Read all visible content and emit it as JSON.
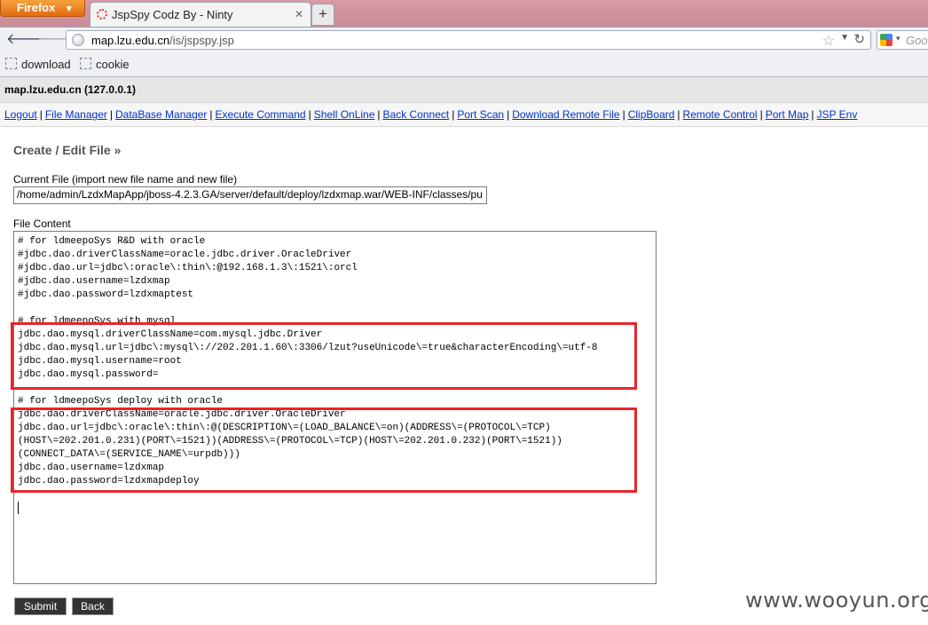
{
  "browser": {
    "app_button": "Firefox",
    "tab_title": "JspSpy Codz By - Ninty",
    "url": "map.lzu.edu.cn/is/jspspy.jsp",
    "url_host": "map.lzu.edu.cn",
    "url_path": "/is/jspspy.jsp",
    "search_placeholder": "Goo"
  },
  "bookmarks": [
    "download",
    "cookie"
  ],
  "page": {
    "host": "map.lzu.edu.cn (127.0.0.1)",
    "menu": [
      "Logout",
      "File Manager",
      "DataBase Manager",
      "Execute Command",
      "Shell OnLine",
      "Back Connect",
      "Port Scan",
      "Download Remote File",
      "ClipBoard",
      "Remote Control",
      "Port Map",
      "JSP Env"
    ],
    "heading": "Create / Edit File »",
    "current_file_label": "Current File (import new file name and new file)",
    "current_file_value": "/home/admin/LzdxMapApp/jboss-4.2.3.GA/server/default/deploy/lzdxmap.war/WEB-INF/classes/pu",
    "file_content_label": "File Content",
    "file_content": "# for ldmeepoSys R&D with oracle\n#jdbc.dao.driverClassName=oracle.jdbc.driver.OracleDriver\n#jdbc.dao.url=jdbc\\:oracle\\:thin\\:@192.168.1.3\\:1521\\:orcl\n#jdbc.dao.username=lzdxmap\n#jdbc.dao.password=lzdxmaptest\n\n# for ldmeepoSys with mysql\njdbc.dao.mysql.driverClassName=com.mysql.jdbc.Driver\njdbc.dao.mysql.url=jdbc\\:mysql\\://202.201.1.60\\:3306/lzut?useUnicode\\=true&characterEncoding\\=utf-8\njdbc.dao.mysql.username=root\njdbc.dao.mysql.password=\n\n# for ldmeepoSys deploy with oracle\njdbc.dao.driverClassName=oracle.jdbc.driver.OracleDriver\njdbc.dao.url=jdbc\\:oracle\\:thin\\:@(DESCRIPTION\\=(LOAD_BALANCE\\=on)(ADDRESS\\=(PROTOCOL\\=TCP)\n(HOST\\=202.201.0.231)(PORT\\=1521))(ADDRESS\\=(PROTOCOL\\=TCP)(HOST\\=202.201.0.232)(PORT\\=1521))\n(CONNECT_DATA\\=(SERVICE_NAME\\=urpdb)))\njdbc.dao.username=lzdxmap\njdbc.dao.password=lzdxmapdeploy",
    "submit_label": "Submit",
    "back_label": "Back"
  },
  "watermark": "www.wooyun.org",
  "colors": {
    "highlight_box": "#e5262b",
    "link": "#0033cc",
    "firefox_button": "#e8781b"
  }
}
